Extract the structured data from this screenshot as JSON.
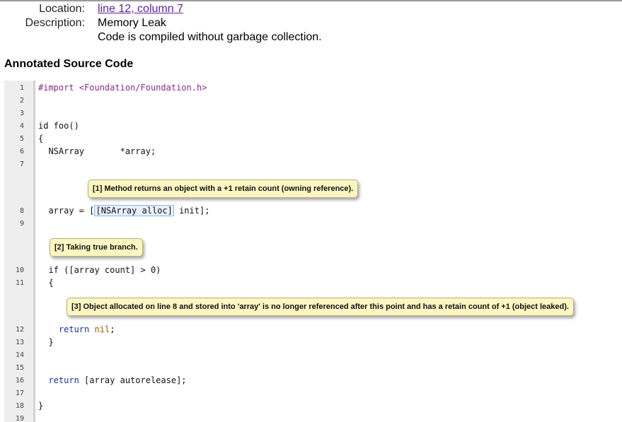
{
  "report": {
    "location_label": "Location:",
    "location_value": "line 12, column 7",
    "description_label": "Description:",
    "description_lines": [
      "Memory Leak",
      "Code is compiled without garbage collection."
    ]
  },
  "source": {
    "section_title": "Annotated Source Code",
    "line_numbers": [
      "1",
      "2",
      "3",
      "4",
      "5",
      "6",
      "7",
      "8",
      "9",
      "10",
      "11",
      "12",
      "13",
      "14",
      "15",
      "16",
      "17",
      "18",
      "19"
    ],
    "code": {
      "l1": "#import <Foundation/Foundation.h>",
      "l4": "id foo()",
      "l5": "{",
      "l6": "  NSArray       *array;",
      "l8_pre": "  array = [",
      "l8_hl": "[NSArray alloc]",
      "l8_post": " init];",
      "l10": "  if ([array count] > 0)",
      "l11": "  {",
      "l12_pre": "    ",
      "l12_kw": "return",
      "l12_sp": " ",
      "l12_nil": "nil",
      "l12_end": ";",
      "l13": "  }",
      "l16_pre": "  ",
      "l16_kw": "return",
      "l16_rest": " [array autorelease];",
      "l18": "}"
    },
    "annotations": [
      "[1] Method returns an object with a +1 retain count (owning reference).",
      "[2] Taking true branch.",
      "[3] Object allocated on line 8 and stored into 'array' is no longer referenced after this point and has a retain count of +1 (object leaked)."
    ]
  }
}
